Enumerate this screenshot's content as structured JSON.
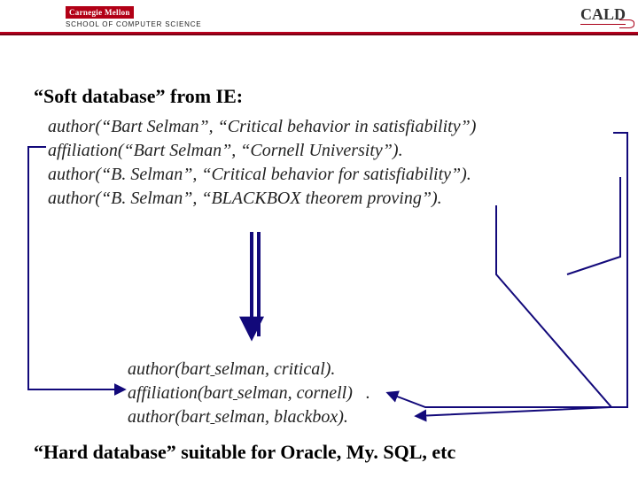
{
  "header": {
    "university": "Carnegie Mellon",
    "school": "SCHOOL OF COMPUTER SCIENCE",
    "right_logo": "CALD"
  },
  "headings": {
    "soft": "“Soft database” from IE:",
    "hard": "“Hard database” suitable for Oracle, My. SQL, etc"
  },
  "soft_db": {
    "r0": "author(“Bart Selman”, “Critical behavior in satisfiability”)",
    "r1": "affiliation(“Bart Selman”, “Cornell University”).",
    "r2": "author(“B. Selman”, “Critical behavior for satisfiability”).",
    "r3": "author(“B. Selman”, “BLACKBOX theorem proving”)."
  },
  "hard_db": {
    "r0_a": "author(bart",
    "r0_b": "selman, critical).",
    "r1_a": "affiliation(bart",
    "r1_b": "selman, cornell)",
    "r1_c": ".",
    "r2_a": "author(bart",
    "r2_b": "selman, blackbox)."
  },
  "colors": {
    "accent": "#b20016",
    "arrow": "#12097a"
  }
}
